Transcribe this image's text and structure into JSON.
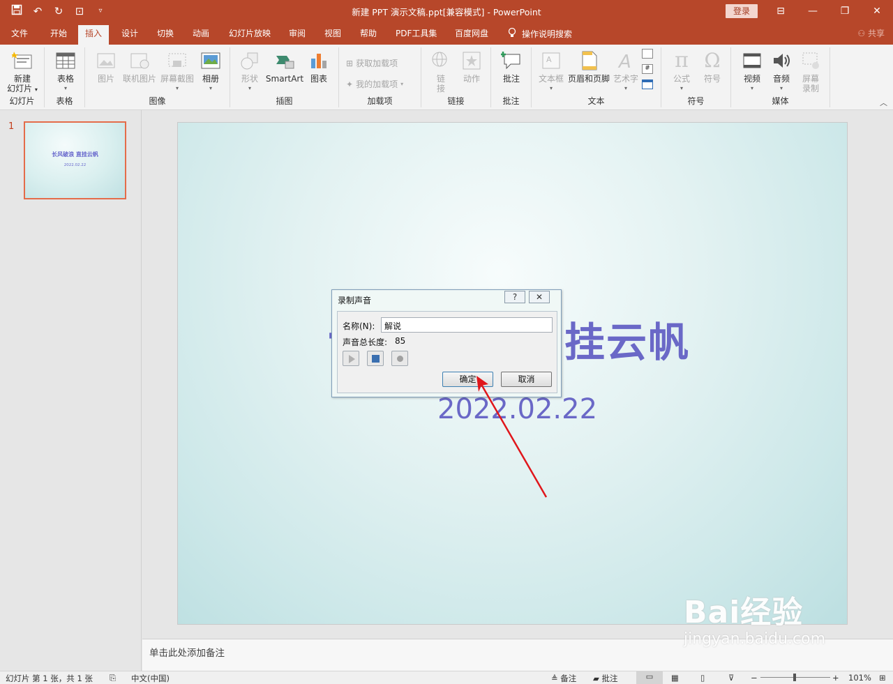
{
  "titlebar": {
    "title": "新建 PPT 演示文稿.ppt[兼容模式]  -  PowerPoint",
    "login": "登录"
  },
  "tabs": [
    "文件",
    "开始",
    "插入",
    "设计",
    "切换",
    "动画",
    "幻灯片放映",
    "审阅",
    "视图",
    "帮助",
    "PDF工具集",
    "百度网盘"
  ],
  "active_tab": "插入",
  "tell_me": "操作说明搜索",
  "share": "共享",
  "ribbon": {
    "groups": {
      "slides": "幻灯片",
      "tables": "表格",
      "images": "图像",
      "illustrations": "插图",
      "addins": "加载项",
      "links": "链接",
      "comments": "批注",
      "text": "文本",
      "symbols": "符号",
      "media": "媒体"
    },
    "buttons": {
      "new_slide_1": "新建",
      "new_slide_2": "幻灯片",
      "table": "表格",
      "picture": "图片",
      "online_picture": "联机图片",
      "screenshot": "屏幕截图",
      "album": "相册",
      "shapes": "形状",
      "smartart": "SmartArt",
      "chart": "图表",
      "get_addins": "获取加载项",
      "my_addins": "我的加载项",
      "link_1": "链",
      "link_2": "接",
      "action": "动作",
      "comment": "批注",
      "textbox": "文本框",
      "header_footer": "页眉和页脚",
      "wordart": "艺术字",
      "equation": "公式",
      "symbol": "符号",
      "video": "视频",
      "audio": "音频",
      "screen_rec_1": "屏幕",
      "screen_rec_2": "录制"
    }
  },
  "thumbnail": {
    "number": "1",
    "title": "长风破浪 直挂云帆",
    "date": "2022.02.22"
  },
  "slide": {
    "title_visible": "挂云帆",
    "date": "2022.02.22"
  },
  "notes_placeholder": "单击此处添加备注",
  "status": {
    "slide_info": "幻灯片 第 1 张，共 1 张",
    "language": "中文(中国)",
    "notes": "备注",
    "comments": "批注",
    "zoom": "101%"
  },
  "dialog": {
    "title": "录制声音",
    "help": "?",
    "close": "✕",
    "name_label": "名称(N):",
    "name_value": "解说",
    "length_label": "声音总长度:",
    "length_value": "85",
    "ok": "确定",
    "cancel": "取消"
  },
  "watermark": {
    "brand": "Bai经验",
    "url": "jingyan.baidu.com"
  },
  "colors": {
    "accent": "#b7472a",
    "slide_text": "#6a68c7",
    "arrow": "#e0161b"
  }
}
